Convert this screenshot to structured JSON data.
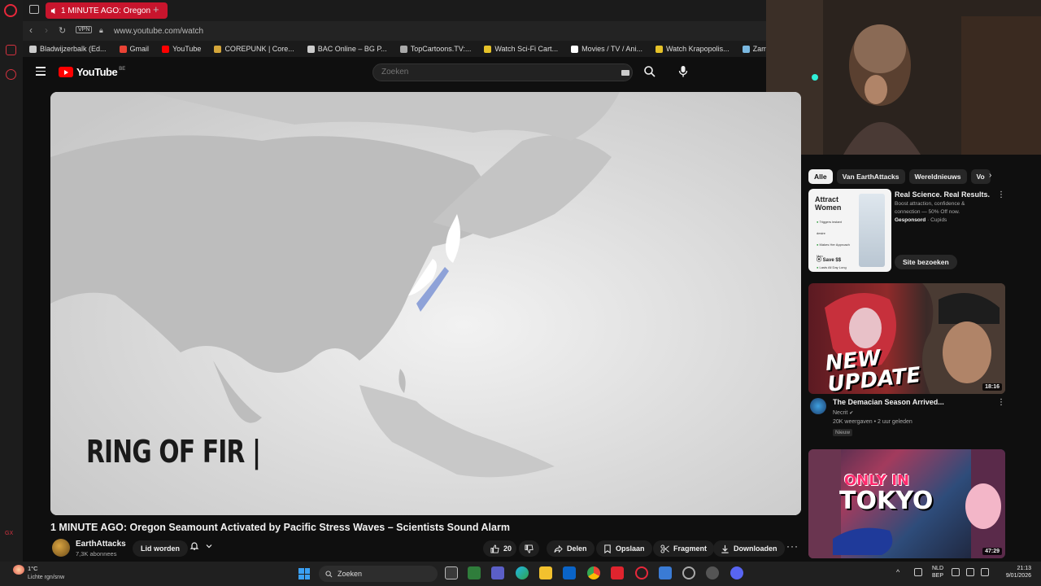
{
  "browser": {
    "active_tab_title": "1 MINUTE AGO: Oregon",
    "address": "www.youtube.com/watch",
    "vpn_label": "VPN",
    "bookmarks": [
      {
        "label": "Bladwijzerbalk (Ed...",
        "color": "#cccccc"
      },
      {
        "label": "Gmail",
        "color": "#ea4335"
      },
      {
        "label": "YouTube",
        "color": "#ff0000"
      },
      {
        "label": "COREPUNK | Core...",
        "color": "#d4a63a"
      },
      {
        "label": "BAC Online – BG P...",
        "color": "#cccccc"
      },
      {
        "label": "TopCartoons.TV:...",
        "color": "#aaaaaa"
      },
      {
        "label": "Watch Sci-Fi Cart...",
        "color": "#e6c229"
      },
      {
        "label": "Movies / TV / Ani...",
        "color": "#ffffff"
      },
      {
        "label": "Watch Krapopolis...",
        "color": "#e6c229"
      },
      {
        "label": "Zamnesia | Het Be",
        "color": "#7ab8e0"
      }
    ]
  },
  "youtube": {
    "logo_text": "YouTube",
    "logo_region": "BE",
    "search_placeholder": "Zoeken"
  },
  "video": {
    "overlay_text": "RING OF FIR |",
    "title": "1 MINUTE AGO: Oregon Seamount Activated by Pacific Stress Waves – Scientists Sound Alarm",
    "channel": "EarthAttacks",
    "subscribers": "7,3K abonnees",
    "join_label": "Lid worden",
    "likes": "20",
    "share_label": "Delen",
    "save_label": "Opslaan",
    "clip_label": "Fragment",
    "download_label": "Downloaden"
  },
  "sidebar": {
    "chips": [
      "Alle",
      "Van EarthAttacks",
      "Wereldnieuws",
      "Vo"
    ],
    "ad": {
      "thumb_title": "Attract Women",
      "thumb_items": [
        "Triggers instant desire",
        "Makes Her Approach Men",
        "Lasts All Day Long"
      ],
      "thumb_save": "Save $$",
      "headline": "Real Science. Real Results.",
      "description": "Boost attraction, confidence & connection — 50% Off now.",
      "sponsored": "Gesponsord",
      "advertiser": "Cupids",
      "button": "Site bezoeken"
    },
    "video1": {
      "thumb_text_1": "NEW",
      "thumb_text_2": "UPDATE",
      "duration": "18:16",
      "title": "The Demacian Season Arrived...",
      "channel": "Necrit",
      "meta": "20K weergaven • 2 uur geleden",
      "badge": "Nieuw"
    },
    "video2": {
      "thumb_text_1": "ONLY IN",
      "thumb_text_2": "TOKYO",
      "duration": "47:29"
    }
  },
  "taskbar": {
    "temperature": "1°C",
    "weather": "Lichte rgn/snw",
    "search_label": "Zoeken",
    "lang1": "NLD",
    "lang2": "BEP",
    "time": "21:13",
    "date": "9/01/2026"
  },
  "colors": {
    "yt_red": "#ff0000",
    "opera_red": "#e8283b",
    "dark_bg": "#0f0f0f",
    "accent_blue": "#3aa0f3"
  }
}
